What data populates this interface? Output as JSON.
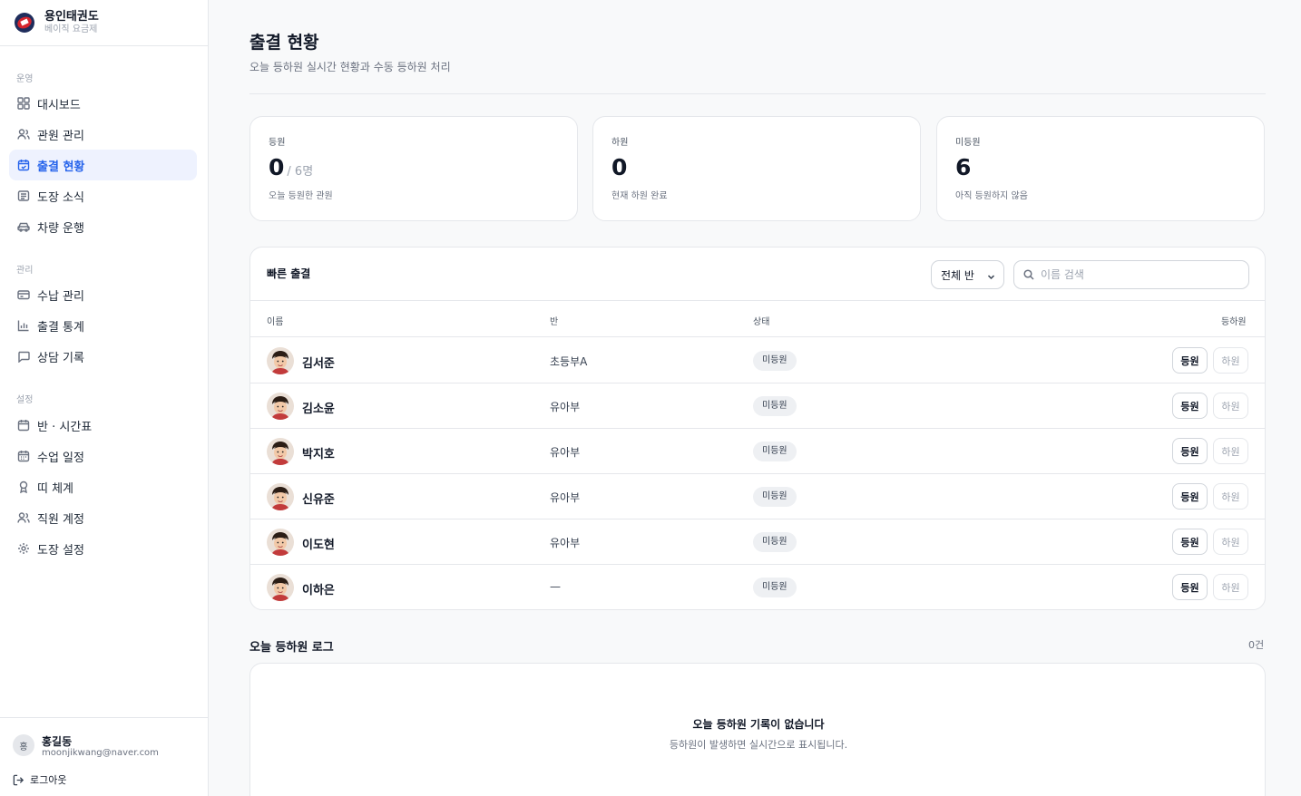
{
  "brand": {
    "name": "용인태권도",
    "plan": "베이직 요금제"
  },
  "nav": {
    "sections": [
      {
        "label": "운영",
        "items": [
          {
            "label": "대시보드",
            "icon": "grid-icon"
          },
          {
            "label": "관원 관리",
            "icon": "users-icon"
          },
          {
            "label": "출결 현황",
            "icon": "calendar-check-icon",
            "active": true
          },
          {
            "label": "도장 소식",
            "icon": "news-icon"
          },
          {
            "label": "차량 운행",
            "icon": "car-icon"
          }
        ]
      },
      {
        "label": "관리",
        "items": [
          {
            "label": "수납 관리",
            "icon": "card-icon"
          },
          {
            "label": "출결 통계",
            "icon": "bar-chart-icon"
          },
          {
            "label": "상담 기록",
            "icon": "message-icon"
          }
        ]
      },
      {
        "label": "설정",
        "items": [
          {
            "label": "반 · 시간표",
            "icon": "calendar-icon"
          },
          {
            "label": "수업 일정",
            "icon": "calendar-days-icon"
          },
          {
            "label": "띠 체계",
            "icon": "award-icon"
          },
          {
            "label": "직원 계정",
            "icon": "users-icon"
          },
          {
            "label": "도장 설정",
            "icon": "gear-icon"
          }
        ]
      }
    ]
  },
  "user": {
    "initial": "홍",
    "name": "홍길동",
    "email": "moonjikwang@naver.com",
    "logout": "로그아웃"
  },
  "header": {
    "title": "출결 현황",
    "subtitle": "오늘 등하원 실시간 현황과 수동 등하원 처리"
  },
  "stats": [
    {
      "label": "등원",
      "value": "0",
      "total": "/ 6명",
      "desc": "오늘 등원한 관원"
    },
    {
      "label": "하원",
      "value": "0",
      "total": "",
      "desc": "현재 하원 완료"
    },
    {
      "label": "미등원",
      "value": "6",
      "total": "",
      "desc": "아직 등원하지 않음"
    }
  ],
  "quick": {
    "title": "빠른 출결",
    "class_filter": "전체 반",
    "search_placeholder": "이름 검색",
    "columns": {
      "name": "이름",
      "class": "반",
      "status": "상태",
      "action": "등하원"
    },
    "rows": [
      {
        "name": "김서준",
        "class": "초등부A",
        "status": "미등원",
        "in": "등원",
        "out": "하원"
      },
      {
        "name": "김소윤",
        "class": "유아부",
        "status": "미등원",
        "in": "등원",
        "out": "하원"
      },
      {
        "name": "박지호",
        "class": "유아부",
        "status": "미등원",
        "in": "등원",
        "out": "하원"
      },
      {
        "name": "신유준",
        "class": "유아부",
        "status": "미등원",
        "in": "등원",
        "out": "하원"
      },
      {
        "name": "이도현",
        "class": "유아부",
        "status": "미등원",
        "in": "등원",
        "out": "하원"
      },
      {
        "name": "이하은",
        "class": "—",
        "status": "미등원",
        "in": "등원",
        "out": "하원"
      }
    ]
  },
  "log": {
    "title": "오늘 등하원 로그",
    "count": "0건",
    "empty_title": "오늘 등하원 기록이 없습니다",
    "empty_sub": "등하원이 발생하면 실시간으로 표시됩니다."
  }
}
